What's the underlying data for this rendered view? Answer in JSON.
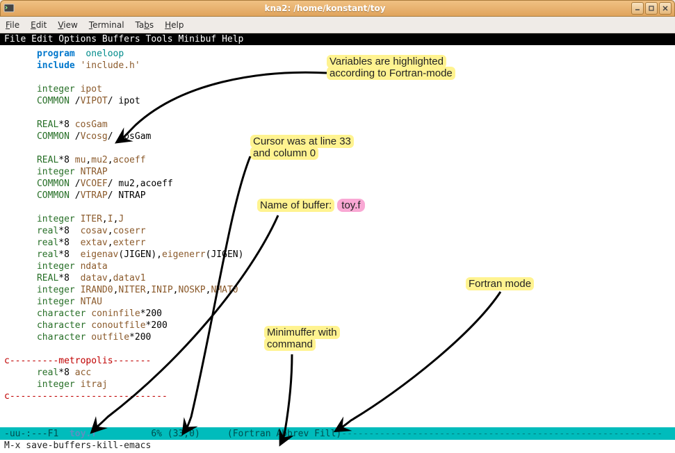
{
  "window": {
    "title": "kna2: /home/konstant/toy",
    "buttons": {
      "min": "_",
      "max": "□",
      "close": "×"
    }
  },
  "terminal_menu": {
    "items": [
      "File",
      "Edit",
      "View",
      "Terminal",
      "Tabs",
      "Help"
    ]
  },
  "emacs_menu": "File Edit Options Buffers Tools Minibuf Help",
  "code": {
    "l1a": "program",
    "l1b": "oneloop",
    "l2a": "include",
    "l2b": "'include.h'",
    "l4a": "integer",
    "l4b": "ipot",
    "l5a": "COMMON",
    "l5b": "VIPOT",
    "l5c": "/ ipot",
    "l7a": "REAL",
    "l7b": "*8",
    "l7c": "cosGam",
    "l8a": "COMMON",
    "l8b": "Vcosg",
    "l8c": "/ cosGam",
    "l10a": "REAL",
    "l10b": "*8",
    "l10c": "mu",
    "l10d": "mu2",
    "l10e": "acoeff",
    "l11a": "integer",
    "l11b": "NTRAP",
    "l12a": "COMMON",
    "l12b": "VCOEF",
    "l12c": "/ mu2,acoeff",
    "l13a": "COMMON",
    "l13b": "VTRAP",
    "l13c": "/ NTRAP",
    "l15a": "integer",
    "l15b": "ITER",
    "l15c": "I",
    "l15d": "J",
    "l16a": "real",
    "l16b": "*8",
    "l16c": "cosav",
    "l16d": "coserr",
    "l17a": "real",
    "l17b": "*8",
    "l17c": "extav",
    "l17d": "exterr",
    "l18a": "real",
    "l18b": "*8",
    "l18c": "eigenav",
    "l18d": "(JIGEN),",
    "l18e": "eigenerr",
    "l18f": "(JIGEN)",
    "l19a": "integer",
    "l19b": "ndata",
    "l20a": "REAL",
    "l20b": "*8",
    "l20c": "datav",
    "l20d": "datav1",
    "l21a": "integer",
    "l21b": "IRAND0",
    "l21c": "NITER",
    "l21d": "INIP",
    "l21e": "NOSKP",
    "l21f": "NMAT0",
    "l22a": "integer",
    "l22b": "NTAU",
    "l23a": "character",
    "l23b": "coninfile",
    "l23c": "*200",
    "l24a": "character",
    "l24b": "conoutfile",
    "l24c": "*200",
    "l25a": "character",
    "l25b": "outfile",
    "l25c": "*200",
    "l27": "c---------metropolis-------",
    "l28a": "real",
    "l28b": "*8",
    "l28c": "acc",
    "l29a": "integer",
    "l29b": "itraj",
    "l30": "c-----------------------------"
  },
  "annotations": {
    "a1_l1": "Variables are highlighted",
    "a1_l2": "according to Fortran-mode",
    "a2_l1": "Cursor was at line 33",
    "a2_l2": "and column 0",
    "a3_l1": "Name of buffer:",
    "a3_l2": "toy.f",
    "a4_l1": "Minimuffer with",
    "a4_l2": "command",
    "a5": "Fortran mode"
  },
  "modeline": {
    "left": "-uu-:---F1  ",
    "bufname": "toy.f",
    "mid": "          6% (33,0)     (Fortran Abbrev Fill)",
    "dashes": "-----------------------------------------------------------"
  },
  "minibuffer": "M-x save-buffers-kill-emacs"
}
